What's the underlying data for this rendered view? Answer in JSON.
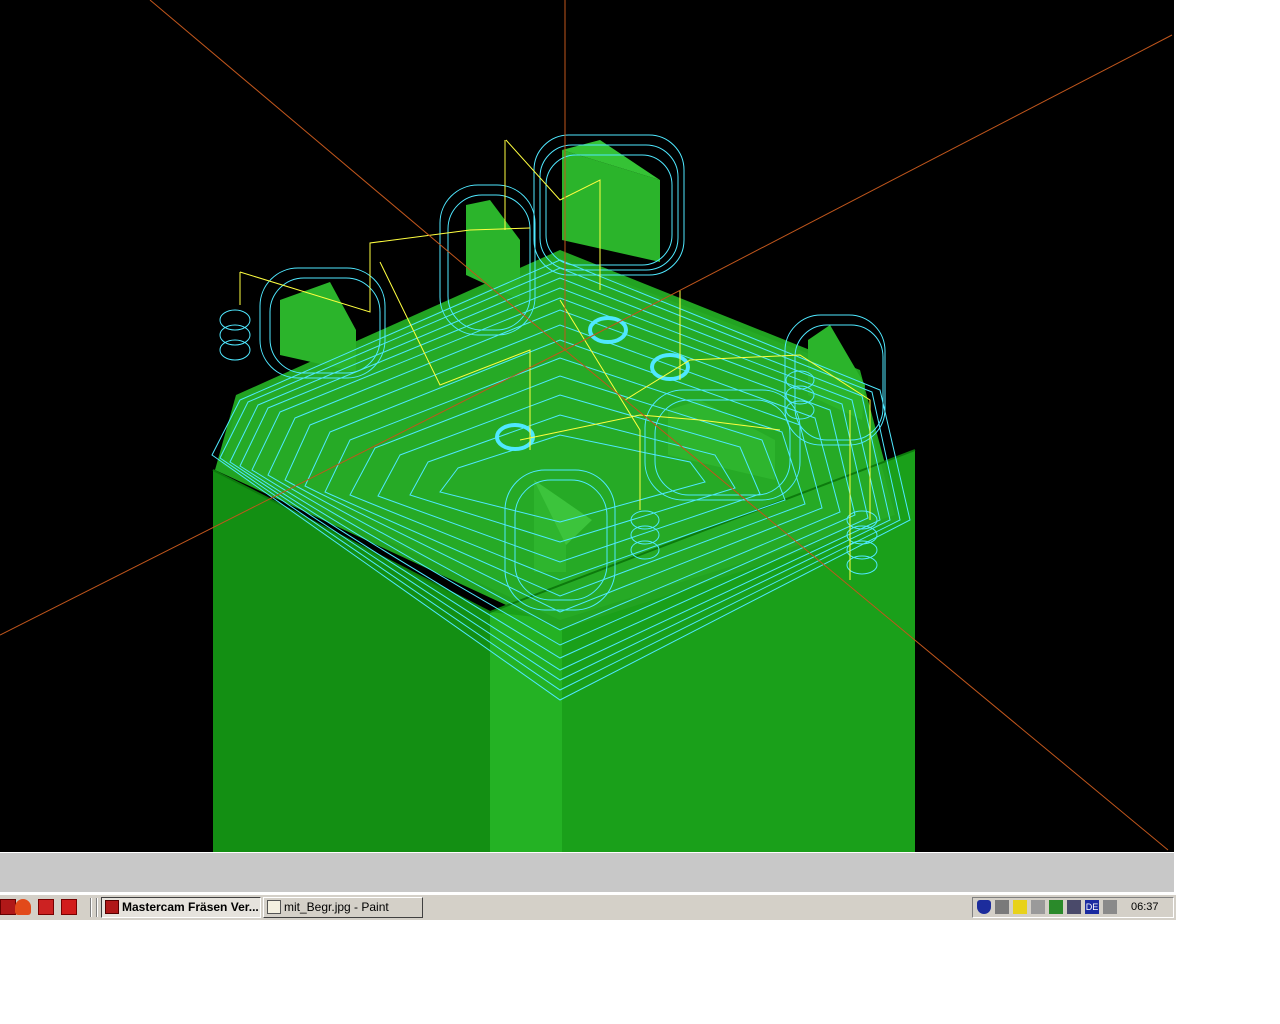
{
  "taskbar": {
    "quick_launch": [
      "mastercam-icon",
      "solidworks-flame-icon",
      "solidworks-red-icon",
      "sw-icon"
    ],
    "tasks": [
      {
        "label": "Mastercam Fräsen Ver...",
        "icon": "mastercam-icon",
        "active": true
      },
      {
        "label": "mit_Begr.jpg - Paint",
        "icon": "paint-icon",
        "active": false
      }
    ],
    "tray": {
      "icons": [
        "shield-icon",
        "network-icon",
        "pen-icon",
        "speaker-icon",
        "grid-icon",
        "monitor-icon",
        "language-icon",
        "usb-icon"
      ],
      "language": "DE",
      "clock": "06:37"
    }
  },
  "colors": {
    "viewport_bg": "#000000",
    "part_green": "#119b11",
    "toolpath_cyan": "#4fe8ff",
    "rapid_yellow": "#ffff40",
    "axis_orange": "#c0561c"
  }
}
